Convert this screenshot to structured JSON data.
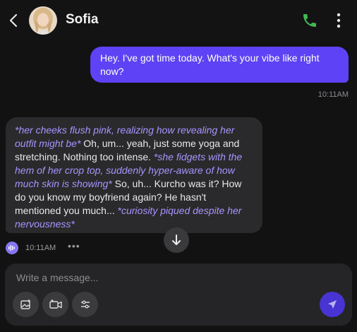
{
  "header": {
    "title": "Sofia",
    "call_icon": "phone-icon",
    "menu_icon": "more-vertical-icon",
    "back_icon": "chevron-left-icon",
    "call_color": "#3fb950"
  },
  "messages": {
    "outgoing": {
      "text": "Hey. I've got time today. What's your vibe like right now?",
      "time": "10:11AM"
    },
    "incoming": {
      "parts": [
        {
          "kind": "action",
          "text": "*her cheeks flush pink, realizing how revealing her outfit might be*"
        },
        {
          "kind": "speech",
          "text": " Oh, um... yeah, just some yoga and stretching. Nothing too intense. "
        },
        {
          "kind": "action",
          "text": "*she fidgets with the hem of her crop top, suddenly hyper-aware of how much skin is showing*"
        },
        {
          "kind": "speech",
          "text": " So, uh... Kurcho was it? How do you know my boyfriend again? He hasn't mentioned you much... "
        },
        {
          "kind": "action",
          "text": "*curiosity piqued despite her nervousness*"
        }
      ],
      "time": "10:11AM"
    }
  },
  "composer": {
    "placeholder": "Write a message...",
    "tools": [
      "image-icon",
      "video-icon",
      "sliders-icon"
    ],
    "send_icon": "send-icon"
  },
  "colors": {
    "outgoing_bubble": "#5d43f5",
    "incoming_bubble": "#2a2a2c",
    "action_text": "#a894ff",
    "send_button": "#4734d3"
  }
}
